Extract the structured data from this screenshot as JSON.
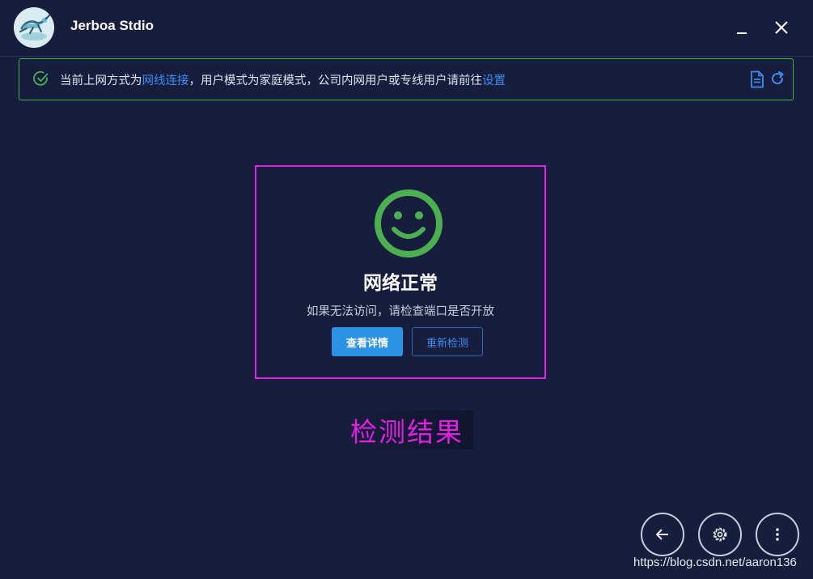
{
  "app": {
    "title": "Jerboa Stdio"
  },
  "notice": {
    "prefix": "当前上网方式为",
    "connection_type": "网线连接",
    "middle": "，用户模式为家庭模式，公司内网用户或专线用户请前往",
    "settings_link": "设置",
    "icons": [
      "check-circle-icon",
      "document-icon",
      "refresh-icon"
    ]
  },
  "result": {
    "title": "网络正常",
    "description": "如果无法访问，请检查端口是否开放",
    "details_button": "查看详情",
    "recheck_button": "重新检测"
  },
  "annotation": {
    "label": "检测结果"
  },
  "fab_buttons": [
    "back-arrow-icon",
    "gear-icon",
    "more-vertical-icon"
  ],
  "watermark": "https://blog.csdn.net/aaron136",
  "colors": {
    "background": "#171d3d",
    "success": "#4caf50",
    "accent": "#2a93e6",
    "link": "#3d8ef0",
    "annotation": "#e021e0"
  }
}
